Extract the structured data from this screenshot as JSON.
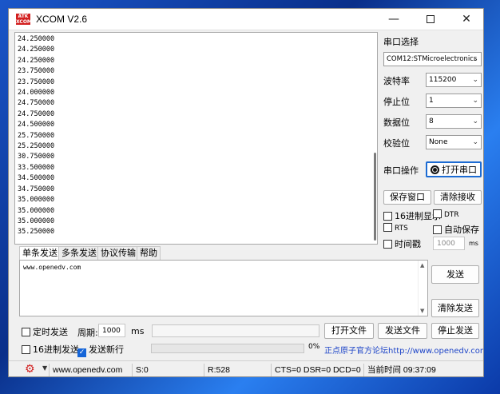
{
  "window": {
    "title": "XCOM V2.6",
    "logo_text": "ATK XCOM"
  },
  "receive": {
    "lines": [
      "24.250000",
      "24.250000",
      "24.250000",
      "23.750000",
      "23.750000",
      "24.000000",
      "24.750000",
      "24.750000",
      "24.500000",
      "25.750000",
      "25.250000",
      "30.750000",
      "33.500000",
      "34.500000",
      "34.750000",
      "35.000000",
      "35.000000",
      "35.000000",
      "35.250000"
    ]
  },
  "side": {
    "port_select_label": "串口选择",
    "port_value": "COM12:STMicroelectronics",
    "baud_label": "波特率",
    "baud_value": "115200",
    "stopbit_label": "停止位",
    "stopbit_value": "1",
    "databit_label": "数据位",
    "databit_value": "8",
    "parity_label": "校验位",
    "parity_value": "None",
    "port_op_label": "串口操作",
    "open_port_button": "打开串口",
    "save_window_button": "保存窗口",
    "clear_receive_button": "清除接收",
    "hex_display_label": "16进制显示",
    "dtr_label": "DTR",
    "rts_label": "RTS",
    "auto_save_label": "自动保存",
    "timestamp_label": "时间戳",
    "timestamp_value": "1000",
    "timestamp_unit": "ms"
  },
  "tabs": [
    "单条发送",
    "多条发送",
    "协议传输",
    "帮助"
  ],
  "send": {
    "text": "www.openedv.com",
    "send_button": "发送",
    "clear_send_button": "清除发送"
  },
  "bottom": {
    "timed_send_label": "定时发送",
    "period_label": "周期:",
    "period_value": "1000",
    "period_unit": "ms",
    "open_file_button": "打开文件",
    "send_file_button": "发送文件",
    "stop_send_button": "停止发送",
    "hex_send_label": "16进制发送",
    "send_newline_label": "发送新行",
    "progress_text": "0%",
    "progress_value": 0,
    "forum_link": "正点原子官方论坛http://www.openedv.com/"
  },
  "status": {
    "website": "www.openedv.com",
    "sent": "S:0",
    "received": "R:528",
    "lines": "CTS=0 DSR=0 DCD=0",
    "time": "当前时间 09:37:09"
  },
  "colors": {
    "accent": "#1565d8",
    "link": "#1f46c8",
    "logo": "#d21e1e"
  }
}
